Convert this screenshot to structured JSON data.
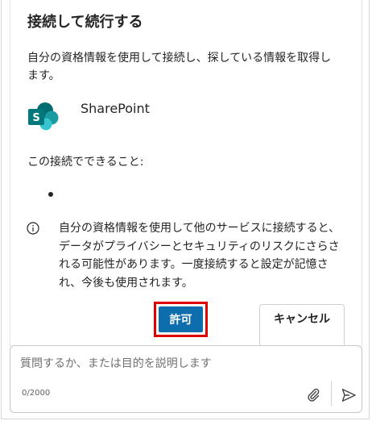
{
  "dialog": {
    "title": "接続して続行する",
    "description": "自分の資格情報を使用して接続し、探している情報を取得します。",
    "app_name": "SharePoint",
    "can_do_label": "この接続でできること:",
    "warning": "自分の資格情報を使用して他のサービスに接続すると、データがプライバシーとセキュリティのリスクにさらされる可能性があります。一度接続すると設定が記憶され、今後も使用されます。",
    "allow_label": "許可",
    "cancel_label": "キャンセル"
  },
  "composer": {
    "placeholder": "質問するか、または目的を説明します",
    "value": "",
    "counter": "0/2000"
  },
  "colors": {
    "accent": "#0e6ead",
    "highlight": "#e00000",
    "sharepoint_dark": "#036c70",
    "sharepoint_mid": "#1a9ba1",
    "sharepoint_light": "#37c6d0"
  },
  "icons": [
    "sharepoint-logo",
    "info-icon",
    "attach-icon",
    "send-icon"
  ]
}
